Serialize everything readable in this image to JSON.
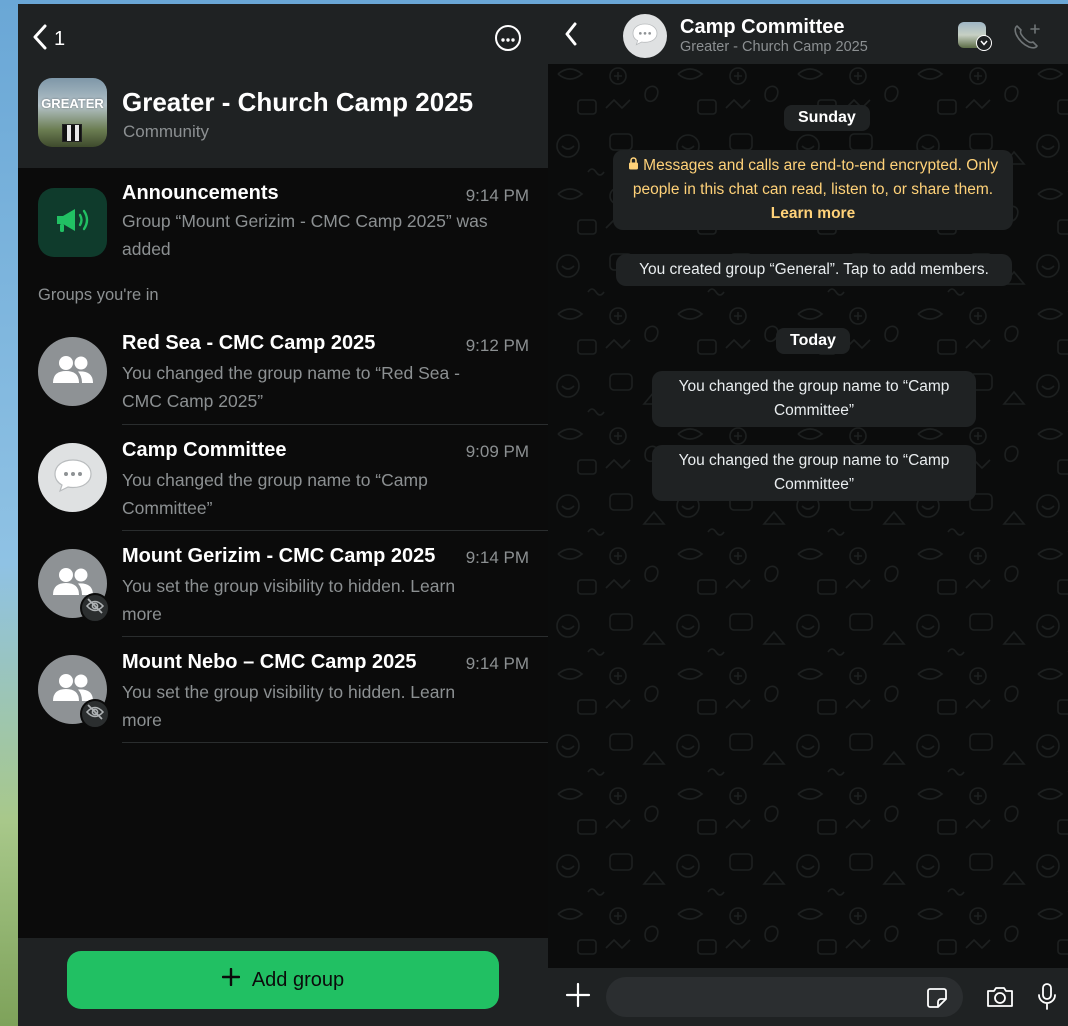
{
  "left": {
    "header": {
      "back_count": "1",
      "community_title": "Greater - Church Camp 2025",
      "community_subtitle": "Community",
      "avatar_text": "GREATER"
    },
    "announcements": {
      "title": "Announcements",
      "time": "9:14 PM",
      "message": "Group “Mount Gerizim - CMC Camp 2025” was added"
    },
    "section_label": "Groups you're in",
    "groups": [
      {
        "title": "Red Sea - CMC Camp 2025",
        "time": "9:12 PM",
        "message": "You changed the group name to “Red Sea - CMC Camp 2025”"
      },
      {
        "title": "Camp Committee",
        "time": "9:09 PM",
        "message": "You changed the group name to “Camp Committee”"
      },
      {
        "title": "Mount Gerizim - CMC Camp 2025",
        "time": "9:14 PM",
        "message": "You set the group visibility to hidden. Learn more"
      },
      {
        "title": "Mount Nebo – CMC Camp 2025",
        "time": "9:14 PM",
        "message": "You set the group visibility to hidden. Learn more"
      }
    ],
    "footer": {
      "add_group_label": "Add group"
    }
  },
  "right": {
    "header": {
      "title": "Camp Committee",
      "subtitle": "Greater - Church Camp 2025"
    },
    "messages": {
      "date_1": "Sunday",
      "encryption_text": "Messages and calls are end-to-end encrypted. Only people in this chat can read, listen to, or share them.",
      "encryption_link": "Learn more",
      "created_group": "You created group “General”. Tap to add members.",
      "date_2": "Today",
      "name_change_1": "You changed the group name to “Camp Committee”",
      "name_change_2": "You changed the group name to “Camp Committee”"
    },
    "composer": {
      "value": "",
      "placeholder": ""
    }
  },
  "colors": {
    "accent_green": "#21c063",
    "panel_dark": "#1f2223",
    "background_black": "#0b0b0b",
    "secondary_text": "#8c9092",
    "encryption_yellow": "#ffd279"
  },
  "icons": [
    "chevron-left-icon",
    "more-icon",
    "megaphone-icon",
    "group-icon",
    "chat-bubble-icon",
    "eye-off-icon",
    "plus-icon",
    "add-call-icon",
    "sticker-icon",
    "camera-icon",
    "mic-icon",
    "lock-icon"
  ]
}
